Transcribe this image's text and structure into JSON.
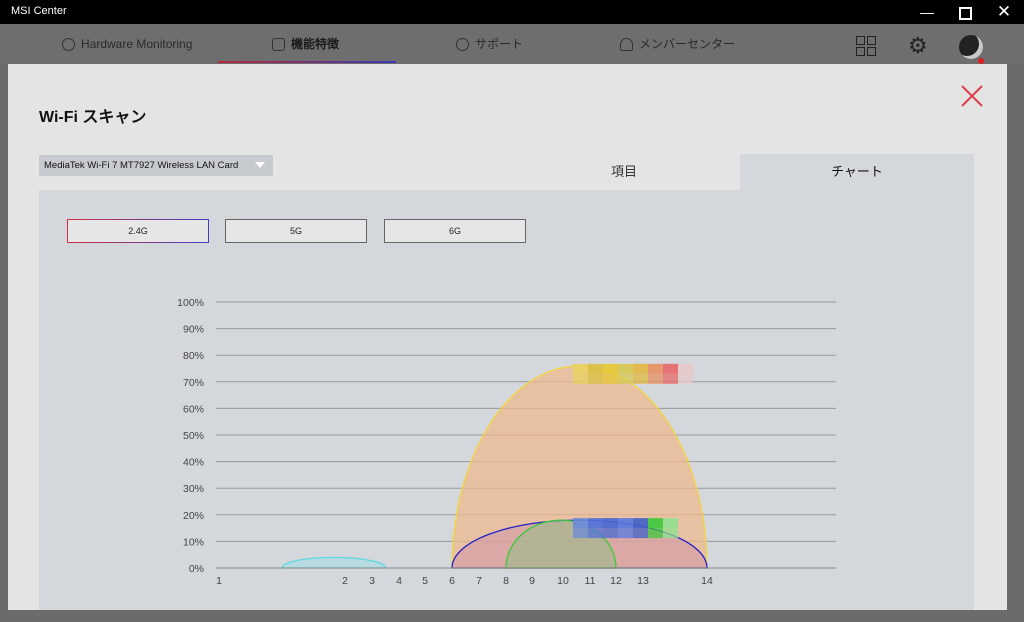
{
  "window": {
    "title": "MSI Center",
    "controls": {
      "minimize": "—",
      "close": "✕"
    }
  },
  "nav": {
    "tabs": [
      {
        "label": "Hardware Monitoring",
        "icon": "gauge-icon"
      },
      {
        "label": "機能特徴",
        "icon": "feature-icon",
        "active": true
      },
      {
        "label": "サポート",
        "icon": "alert-icon"
      },
      {
        "label": "メンバーセンター",
        "icon": "user-icon"
      }
    ],
    "right_icons": [
      "grid-icon",
      "gear-icon",
      "avatar"
    ]
  },
  "modal": {
    "title": "Wi-Fi スキャン",
    "adapter": "MediaTek Wi-Fi 7 MT7927 Wireless LAN Card",
    "tabs": {
      "items": "項目",
      "chart": "チャート"
    },
    "active_tab": "chart",
    "bands": [
      "2.4G",
      "5G",
      "6G"
    ],
    "selected_band": "2.4G"
  },
  "chart_data": {
    "type": "area",
    "y_ticks": [
      "100%",
      "90%",
      "80%",
      "70%",
      "60%",
      "50%",
      "40%",
      "30%",
      "20%",
      "10%",
      "0%"
    ],
    "x_ticks": [
      "1",
      "2",
      "3",
      "4",
      "5",
      "6",
      "7",
      "8",
      "9",
      "10",
      "11",
      "12",
      "13",
      "14"
    ],
    "ylim": [
      0,
      100
    ],
    "series": [
      {
        "from": 1.5,
        "to": 3.5,
        "peak": 4,
        "color": "#5cd8e0",
        "fill": "rgba(150,225,230,0.45)"
      },
      {
        "from": 6,
        "to": 14,
        "peak": 76,
        "color": "#f2d640",
        "fill": "rgba(240,185,140,0.72)"
      },
      {
        "from": 6,
        "to": 14,
        "peak": 18,
        "color": "#2323c8",
        "fill": "rgba(205,150,170,0.55)"
      },
      {
        "from": 8,
        "to": 12,
        "peak": 18,
        "color": "#3cc83c",
        "fill": "rgba(160,185,140,0.65)"
      }
    ],
    "redacted_labels": [
      {
        "x": 12,
        "y": 73,
        "colors": [
          "#e8d060",
          "#dcc040",
          "#e6c830",
          "#d8c850",
          "#e2b840",
          "#e89060",
          "#e86868",
          "#e8c8c8"
        ]
      },
      {
        "x": 12,
        "y": 15,
        "colors": [
          "#6a8ad8",
          "#5070d8",
          "#4868d0",
          "#5878e0",
          "#4060c8",
          "#3cc83c",
          "#90e090"
        ]
      }
    ]
  }
}
